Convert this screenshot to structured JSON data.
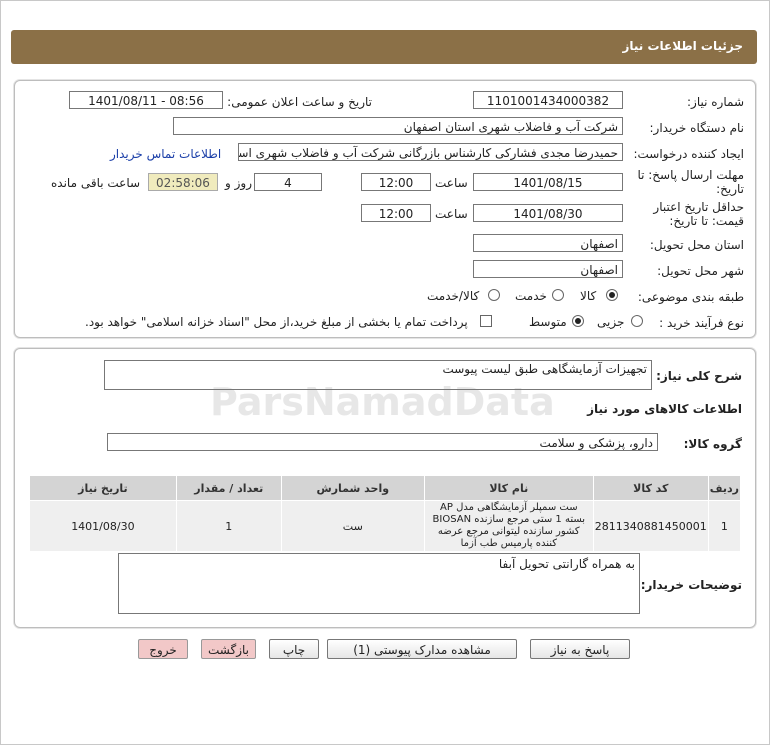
{
  "title": "جزئیات اطلاعات نیاز",
  "fields": {
    "need_number_label": "شماره نیاز:",
    "need_number": "1101001434000382",
    "announce_label": "تاریخ و ساعت اعلان عمومی:",
    "announce_value": "1401/08/11 - 08:56",
    "buyer_org_label": "نام دستگاه خریدار:",
    "buyer_org": "شرکت آب و فاضلاب شهری استان اصفهان",
    "requester_label": "ایجاد کننده درخواست:",
    "requester": "حمیدرضا مجدی فشارکی کارشناس بازرگانی شرکت آب و فاضلاب شهری استان",
    "contact_link": "اطلاعات تماس خریدار",
    "deadline_label_1": "مهلت ارسال پاسخ: تا",
    "deadline_label_2": "تاریخ:",
    "deadline_date": "1401/08/15",
    "time_label": "ساعت",
    "deadline_time": "12:00",
    "days_value": "4",
    "days_label": "روز و",
    "remaining_time": "02:58:06",
    "remaining_label": "ساعت باقی مانده",
    "validity_label_1": "حداقل تاریخ اعتبار",
    "validity_label_2": "قیمت: تا تاریخ:",
    "validity_date": "1401/08/30",
    "validity_time_label": "ساعت",
    "validity_time": "12:00",
    "province_label": "استان محل تحویل:",
    "province": "اصفهان",
    "city_label": "شهر محل تحویل:",
    "city": "اصفهان",
    "category_label": "طبقه بندی موضوعی:",
    "category_options": [
      "کالا",
      "خدمت",
      "کالا/خدمت"
    ],
    "process_label": "نوع فرآیند خرید :",
    "process_options": [
      "جزیی",
      "متوسط"
    ],
    "payment_note": "پرداخت تمام یا بخشی از مبلغ خرید،از محل \"اسناد خزانه اسلامی\" خواهد بود."
  },
  "summary": {
    "label": "شرح کلی نیاز:",
    "value": "تجهیزات آزمایشگاهی طبق لیست پیوست",
    "goods_info_label": "اطلاعات کالاهای مورد نیاز",
    "group_label": "گروه کالا:",
    "group_value": "دارو، پزشکی و سلامت"
  },
  "table": {
    "headers": [
      "ردیف",
      "کد کالا",
      "نام کالا",
      "واحد شمارش",
      "تعداد / مقدار",
      "تاریخ نیاز"
    ],
    "rows": [
      [
        "1",
        "2811340881450001",
        "ست سمپلر آزمایشگاهی مدل AP بسته 1 ستی مرجع سازنده BIOSAN کشور سازنده لیتوانی مرجع عرضه کننده پارمیس طب آزما",
        "ست",
        "1",
        "1401/08/30"
      ]
    ]
  },
  "buyer_notes": {
    "label": "توضیحات خریدار:",
    "value": "به همراه گارانتی تحویل آبفا"
  },
  "buttons": {
    "reply": "پاسخ به نیاز",
    "attachments": "مشاهده مدارک پیوستی (1)",
    "print": "چاپ",
    "back": "بازگشت",
    "exit": "خروج"
  },
  "watermark": {
    "brand": "ParsNamadData"
  }
}
